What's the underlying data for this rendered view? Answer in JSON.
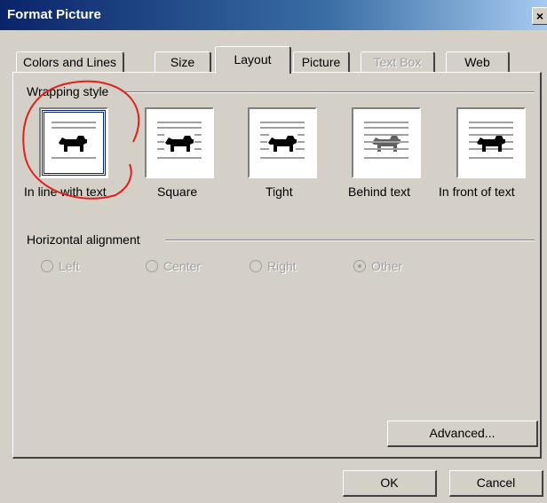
{
  "window": {
    "title": "Format Picture",
    "close_label": "×"
  },
  "tabs": [
    {
      "label": "Colors and Lines",
      "state": "normal"
    },
    {
      "label": "Size",
      "state": "normal"
    },
    {
      "label": "Layout",
      "state": "active"
    },
    {
      "label": "Picture",
      "state": "normal"
    },
    {
      "label": "Text Box",
      "state": "disabled"
    },
    {
      "label": "Web",
      "state": "normal"
    }
  ],
  "wrapping_style": {
    "group_label": "Wrapping style",
    "options": [
      {
        "label": "In line with text",
        "icon": "inline-wrap-icon",
        "selected": true
      },
      {
        "label": "Square",
        "icon": "square-wrap-icon",
        "selected": false
      },
      {
        "label": "Tight",
        "icon": "tight-wrap-icon",
        "selected": false
      },
      {
        "label": "Behind text",
        "icon": "behind-text-wrap-icon",
        "selected": false
      },
      {
        "label": "In front of text",
        "icon": "in-front-of-text-wrap-icon",
        "selected": false
      }
    ]
  },
  "horizontal_alignment": {
    "group_label": "Horizontal alignment",
    "enabled": false,
    "options": [
      {
        "label": "Left",
        "checked": false
      },
      {
        "label": "Center",
        "checked": false
      },
      {
        "label": "Right",
        "checked": false
      },
      {
        "label": "Other",
        "checked": true
      }
    ]
  },
  "buttons": {
    "advanced": "Advanced...",
    "ok": "OK",
    "cancel": "Cancel"
  },
  "colors": {
    "title_bar": "#0a246a",
    "face": "#d4d0c8",
    "annotation": "#e0201c"
  }
}
